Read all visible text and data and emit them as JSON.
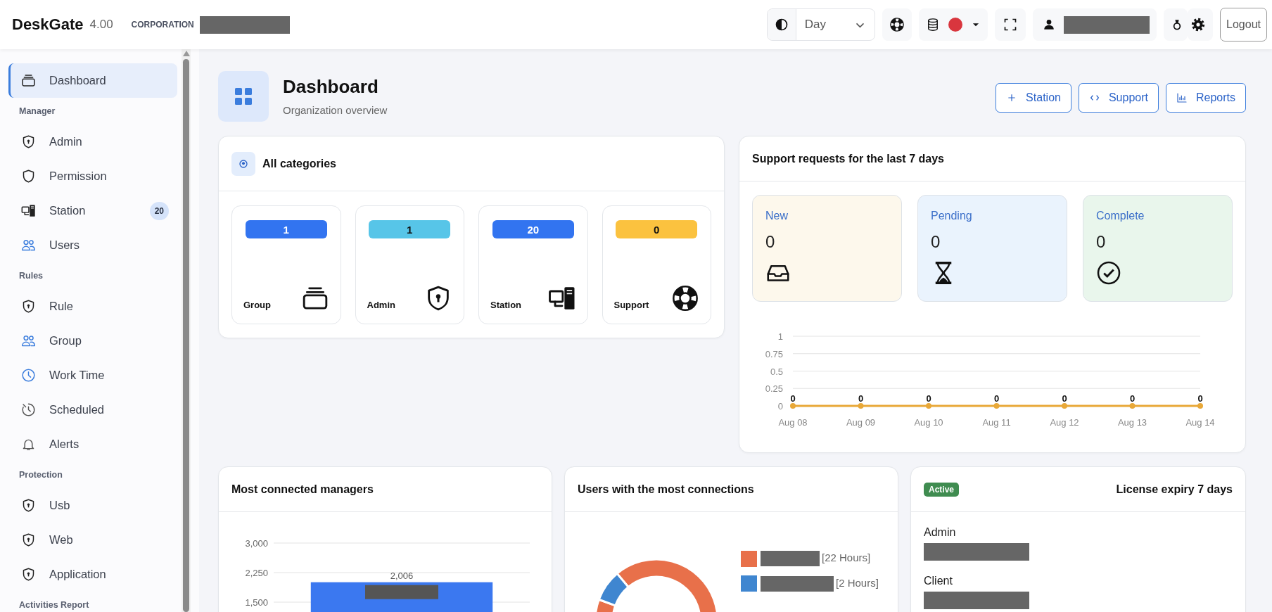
{
  "header": {
    "brand": "DeskGate",
    "version": "4.00",
    "org_label": "CORPORATION",
    "theme": "Day",
    "database": {
      "online": false
    },
    "logout": "Logout"
  },
  "sidebar": {
    "items": [
      {
        "label": "Dashboard",
        "selected": true
      }
    ],
    "sections": [
      {
        "title": "Manager",
        "items": [
          {
            "label": "Admin",
            "selected": false
          },
          {
            "label": "Permission",
            "selected": false
          },
          {
            "label": "Station",
            "selected": false,
            "badge": "20"
          },
          {
            "label": "Users",
            "selected": false
          }
        ]
      },
      {
        "title": "Rules",
        "items": [
          {
            "label": "Rule",
            "selected": false
          },
          {
            "label": "Group",
            "selected": false
          },
          {
            "label": "Work Time",
            "selected": false
          },
          {
            "label": "Scheduled",
            "selected": false
          },
          {
            "label": "Alerts",
            "selected": false
          }
        ]
      },
      {
        "title": "Protection",
        "items": [
          {
            "label": "Usb",
            "selected": false
          },
          {
            "label": "Web",
            "selected": false
          },
          {
            "label": "Application",
            "selected": false
          }
        ]
      },
      {
        "title": "Activities Report"
      }
    ]
  },
  "page": {
    "title": "Dashboard",
    "subtitle": "Organization overview",
    "actions": [
      {
        "label": "Station"
      },
      {
        "label": "Support"
      },
      {
        "label": "Reports"
      }
    ]
  },
  "categories": {
    "title": "All categories",
    "items": [
      {
        "label": "Group",
        "count": "1",
        "color": "#3274f0"
      },
      {
        "label": "Admin",
        "count": "1",
        "color": "#57c5e8"
      },
      {
        "label": "Station",
        "count": "20",
        "color": "#3274f0"
      },
      {
        "label": "Support",
        "count": "0",
        "color": "#fbc23f"
      }
    ]
  },
  "support_requests": {
    "title": "Support requests for the last 7 days",
    "statuses": [
      {
        "label": "New",
        "count": "0",
        "color": "#fdf8ec"
      },
      {
        "label": "Pending",
        "count": "0",
        "color": "#eaf3fd"
      },
      {
        "label": "Complete",
        "count": "0",
        "color": "#e9f6ec"
      }
    ],
    "chart_data": {
      "type": "line",
      "categories": [
        "Aug 08",
        "Aug 09",
        "Aug 10",
        "Aug 11",
        "Aug 12",
        "Aug 13",
        "Aug 14"
      ],
      "series": [
        {
          "color": "#e8a838",
          "marker": true,
          "values": [
            0,
            0,
            0,
            0,
            0,
            0,
            0
          ]
        }
      ],
      "yticks": [
        0,
        0.25,
        0.5,
        0.75,
        1
      ],
      "ylim": [
        0,
        1
      ],
      "grid": true,
      "data_labels": true
    }
  },
  "managers": {
    "title": "Most connected managers",
    "chart_data": {
      "type": "bar",
      "series": [
        {
          "color": "#3b78f0",
          "values": [
            2006
          ]
        }
      ],
      "yticks": [
        {
          "value": 1500,
          "label": "1,500"
        },
        {
          "value": 2250,
          "label": "2,250"
        },
        {
          "value": 3000,
          "label": "3,000"
        }
      ],
      "ylim": [
        0,
        3000
      ],
      "grid": true,
      "value_labels": [
        "2,006"
      ]
    }
  },
  "connections": {
    "title": "Users with the most connections",
    "chart_data": {
      "type": "donut",
      "categories": [
        "[22 Hours]",
        "[2 Hours]"
      ],
      "colors": [
        "#e8704a",
        "#3f86d0"
      ],
      "series": [
        {
          "values": [
            22,
            2
          ]
        }
      ]
    }
  },
  "license": {
    "badge": "Active",
    "title": "License expiry 7 days",
    "rows": [
      "Admin",
      "Client"
    ]
  }
}
